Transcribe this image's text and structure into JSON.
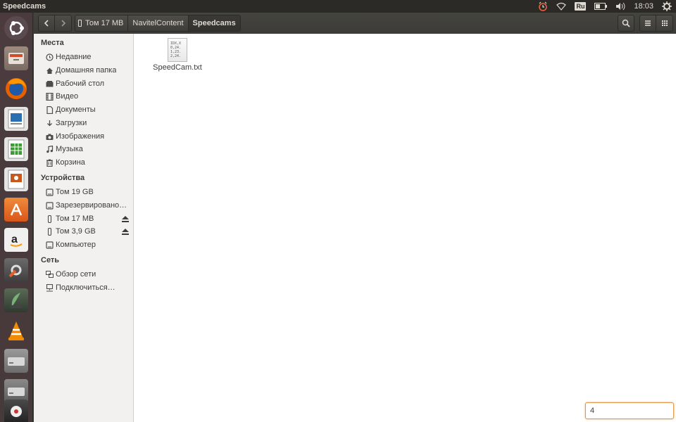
{
  "top_panel": {
    "app_title": "Speedcams",
    "keyboard_layout": "Ru",
    "clock": "18:03",
    "icons": [
      "alarm-clock-icon",
      "wifi-icon",
      "keyboard-layout-badge",
      "battery-icon",
      "volume-icon",
      "gear-icon"
    ]
  },
  "launcher": {
    "items": [
      "ubuntu-dash",
      "files",
      "firefox",
      "writer",
      "calc",
      "impress",
      "software-center",
      "amazon",
      "system-settings",
      "app",
      "vlc",
      "drive",
      "drive",
      "settings"
    ]
  },
  "toolbar": {
    "breadcrumbs": [
      "Том 17 MB",
      "NavitelContent",
      "Speedcams"
    ]
  },
  "sidebar": {
    "places_heading": "Места",
    "places": [
      {
        "label": "Недавние",
        "icon": "clock-icon"
      },
      {
        "label": "Домашняя папка",
        "icon": "home-icon"
      },
      {
        "label": "Рабочий стол",
        "icon": "folder-icon"
      },
      {
        "label": "Видео",
        "icon": "film-icon"
      },
      {
        "label": "Документы",
        "icon": "document-icon"
      },
      {
        "label": "Загрузки",
        "icon": "download-icon"
      },
      {
        "label": "Изображения",
        "icon": "camera-icon"
      },
      {
        "label": "Музыка",
        "icon": "music-icon"
      },
      {
        "label": "Корзина",
        "icon": "trash-icon"
      }
    ],
    "devices_heading": "Устройства",
    "devices": [
      {
        "label": "Том 19 GB",
        "icon": "drive-icon",
        "eject": false
      },
      {
        "label": "Зарезервировано…",
        "icon": "drive-icon",
        "eject": false
      },
      {
        "label": "Том 17 MB",
        "icon": "usb-icon",
        "eject": true
      },
      {
        "label": "Том 3,9 GB",
        "icon": "usb-icon",
        "eject": true
      },
      {
        "label": "Компьютер",
        "icon": "drive-icon",
        "eject": false
      }
    ],
    "network_heading": "Сеть",
    "network": [
      {
        "label": "Обзор сети",
        "icon": "network-icon"
      },
      {
        "label": "Подключиться…",
        "icon": "connect-icon"
      }
    ]
  },
  "content": {
    "files": [
      {
        "name": "SpeedCam.txt",
        "preview_lines": [
          "IDX,X",
          "0,24.",
          "1,23.",
          "2,24."
        ]
      }
    ]
  },
  "typeahead": {
    "value": "4"
  }
}
